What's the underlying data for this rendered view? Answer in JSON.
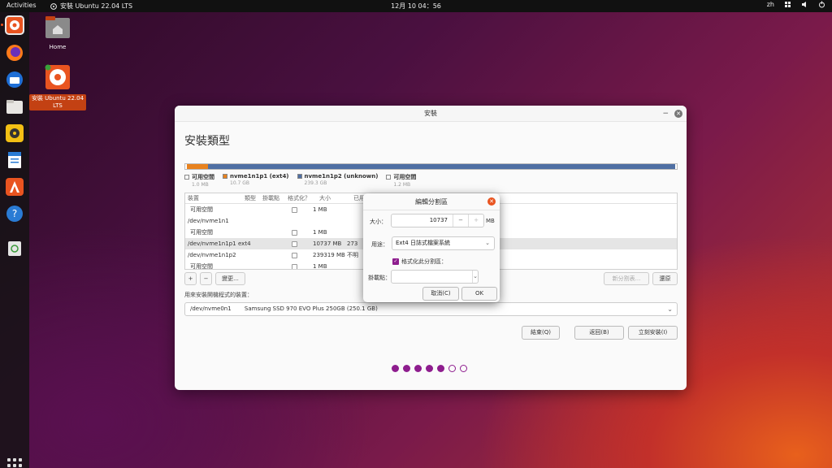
{
  "topbar": {
    "activities": "Activities",
    "app_title": "安裝 Ubuntu 22.04 LTS",
    "clock": "12月 10 04：56",
    "input_method": "zh"
  },
  "desktop": {
    "home_label": "Home",
    "installer_label": "安裝 Ubuntu 22.04 LTS"
  },
  "window": {
    "title": "安裝",
    "heading": "安裝類型"
  },
  "legend": [
    {
      "name": "可用空間",
      "size": "1.0 MB",
      "color": "#ffffff"
    },
    {
      "name": "nvme1n1p1 (ext4)",
      "size": "10.7 GB",
      "color": "#e8821e"
    },
    {
      "name": "nvme1n1p2 (unknown)",
      "size": "239.3 GB",
      "color": "#4f6fa3"
    },
    {
      "name": "可用空間",
      "size": "1.2 MB",
      "color": "#ffffff"
    }
  ],
  "table": {
    "headers": {
      "device": "裝置",
      "type": "類型",
      "mount": "掛載點",
      "format": "格式化？",
      "size": "大小",
      "used": "已用"
    },
    "rows": [
      {
        "device": "可用空間",
        "type": "",
        "size": "1 MB",
        "used": "",
        "show_check": true,
        "indent": true
      },
      {
        "device": "/dev/nvme1n1",
        "type": "",
        "size": "",
        "used": "",
        "show_check": false,
        "indent": false
      },
      {
        "device": "可用空間",
        "type": "",
        "size": "1 MB",
        "used": "",
        "show_check": true,
        "indent": true
      },
      {
        "device": "/dev/nvme1n1p1",
        "type": "ext4",
        "size": "10737 MB",
        "used": "273",
        "show_check": true,
        "indent": false,
        "selected": true
      },
      {
        "device": "/dev/nvme1n1p2",
        "type": "",
        "size": "239319 MB",
        "used": "不明",
        "show_check": true,
        "indent": false
      },
      {
        "device": "可用空間",
        "type": "",
        "size": "1 MB",
        "used": "",
        "show_check": true,
        "indent": true
      }
    ]
  },
  "toolbar": {
    "add": "+",
    "remove": "−",
    "change": "變更...",
    "new_table": "新分割表...",
    "revert": "還原"
  },
  "boot": {
    "label": "用來安裝開機程式的裝置：",
    "device": "/dev/nvme0n1",
    "description": "Samsung SSD 970 EVO Plus 250GB (250.1 GB)"
  },
  "buttons": {
    "quit": "結束(Q)",
    "back": "返回(B)",
    "install": "立刻安裝(I)"
  },
  "progress": {
    "current_step": 5,
    "total_steps": 7
  },
  "dialog": {
    "title": "編輯分割區",
    "size_label": "大小：",
    "size_value": "10737",
    "size_unit": "MB",
    "use_as_label": "用途：",
    "use_as_value": "Ext4 日誌式檔案系統",
    "format_label": "格式化此分割區：",
    "format_checked": true,
    "mount_label": "掛載點：",
    "mount_value": "",
    "cancel": "取消(C)",
    "ok": "OK"
  }
}
